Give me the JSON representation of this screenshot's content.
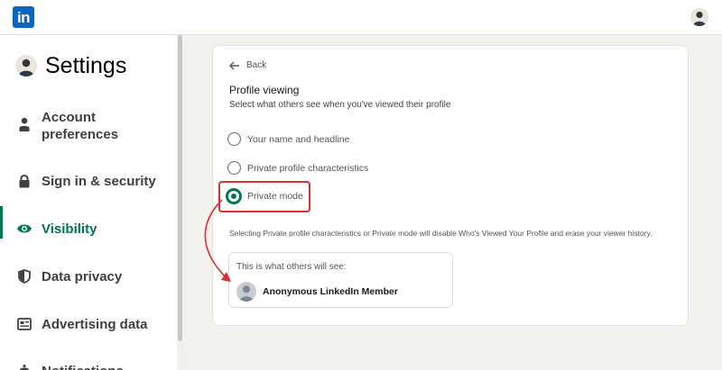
{
  "topbar": {
    "logo_text": "in",
    "logo_icon": "linkedin-logo",
    "brand_color": "#0a66c2"
  },
  "sidebar": {
    "title": "Settings",
    "items": [
      {
        "label": "Account preferences",
        "icon": "person-icon",
        "active": false
      },
      {
        "label": "Sign in & security",
        "icon": "lock-icon",
        "active": false
      },
      {
        "label": "Visibility",
        "icon": "eye-icon",
        "active": true
      },
      {
        "label": "Data privacy",
        "icon": "shield-icon",
        "active": false
      },
      {
        "label": "Advertising data",
        "icon": "newspaper-icon",
        "active": false
      },
      {
        "label": "Notifications",
        "icon": "bell-icon",
        "active": false
      }
    ],
    "active_color": "#01754f"
  },
  "main": {
    "back_label": "Back",
    "title": "Profile viewing",
    "subtitle": "Select what others see when you've viewed their profile",
    "options": [
      {
        "label": "Your name and headline",
        "selected": false
      },
      {
        "label": "Private profile characteristics",
        "selected": false
      },
      {
        "label": "Private mode",
        "selected": true
      }
    ],
    "note": "Selecting Private profile characteristics or Private mode will disable Who's Viewed Your Profile and erase your viewer history.",
    "preview": {
      "label": "This is what others will see:",
      "name": "Anonymous LinkedIn Member"
    }
  },
  "annotation": {
    "color": "#d9312f"
  }
}
